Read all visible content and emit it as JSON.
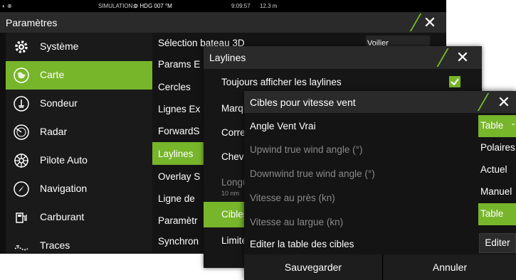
{
  "status": {
    "left_icons": "◐ ⊕",
    "mode": "SIMULATION...",
    "heading": "⚙ HDG 007 °M",
    "time": "9:09:57",
    "distance": "12.3 m"
  },
  "settings": {
    "title": "Paramètres",
    "close_label": "✕",
    "sidebar": [
      {
        "label": "Système",
        "icon": "gear-icon",
        "selected": false
      },
      {
        "label": "Carte",
        "icon": "chart-icon",
        "selected": true
      },
      {
        "label": "Sondeur",
        "icon": "sonar-icon",
        "selected": false
      },
      {
        "label": "Radar",
        "icon": "radar-icon",
        "selected": false
      },
      {
        "label": "Pilote Auto",
        "icon": "autopilot-icon",
        "selected": false
      },
      {
        "label": "Navigation",
        "icon": "compass-icon",
        "selected": false
      },
      {
        "label": "Carburant",
        "icon": "fuel-icon",
        "selected": false
      },
      {
        "label": "Traces",
        "icon": "tracks-icon",
        "selected": false
      }
    ],
    "list": [
      {
        "label": "Sélection bateau 3D",
        "selected": false
      },
      {
        "label": "Params E",
        "selected": false
      },
      {
        "label": "Cercles",
        "selected": false
      },
      {
        "label": "Lignes Ex",
        "selected": false
      },
      {
        "label": "ForwardS",
        "selected": false
      },
      {
        "label": "Laylines",
        "selected": true
      },
      {
        "label": "Overlay S",
        "selected": false
      },
      {
        "label": "Ligne de",
        "selected": false
      },
      {
        "label": "Paramètr",
        "selected": false
      },
      {
        "label": "Synchron",
        "selected": false
      }
    ],
    "boat_select_value": "Voilier"
  },
  "laylines": {
    "title": "Laylines",
    "close_label": "✕",
    "always_show_label": "Toujours afficher les laylines",
    "always_show_checked": true,
    "items": [
      {
        "label": "Marq",
        "selected": false
      },
      {
        "label": "Corre",
        "selected": false
      },
      {
        "label": "Cheva",
        "selected": false
      },
      {
        "label": "Longu",
        "sub": "10 nm",
        "selected": false
      },
      {
        "label": "Cibles",
        "selected": true
      },
      {
        "label": "Limite",
        "selected": false
      }
    ]
  },
  "targets": {
    "title": "Cibles pour vitesse vent",
    "close_label": "✕",
    "rows": [
      {
        "label": "Angle Vent Vrai",
        "enabled": true
      },
      {
        "label": "Upwind true wind angle (°)",
        "enabled": false
      },
      {
        "label": "Downwind true wind angle (°)",
        "enabled": false
      },
      {
        "label": "Vitesse au près (kn)",
        "enabled": false
      },
      {
        "label": "Vitesse au largue (kn)",
        "enabled": false
      },
      {
        "label": "Editer la table des cibles",
        "enabled": true
      }
    ],
    "dropdown_value": "Table",
    "dropdown_options": [
      "Polaires",
      "Actuel",
      "Manuel",
      "Table"
    ],
    "dropdown_selected_option": "Table",
    "edit_button": "Editer",
    "save_button": "Sauvegarder",
    "cancel_button": "Annuler"
  },
  "colors": {
    "accent": "#77b52b",
    "panel": "#141414",
    "title_bar": "#2a2a2a"
  }
}
